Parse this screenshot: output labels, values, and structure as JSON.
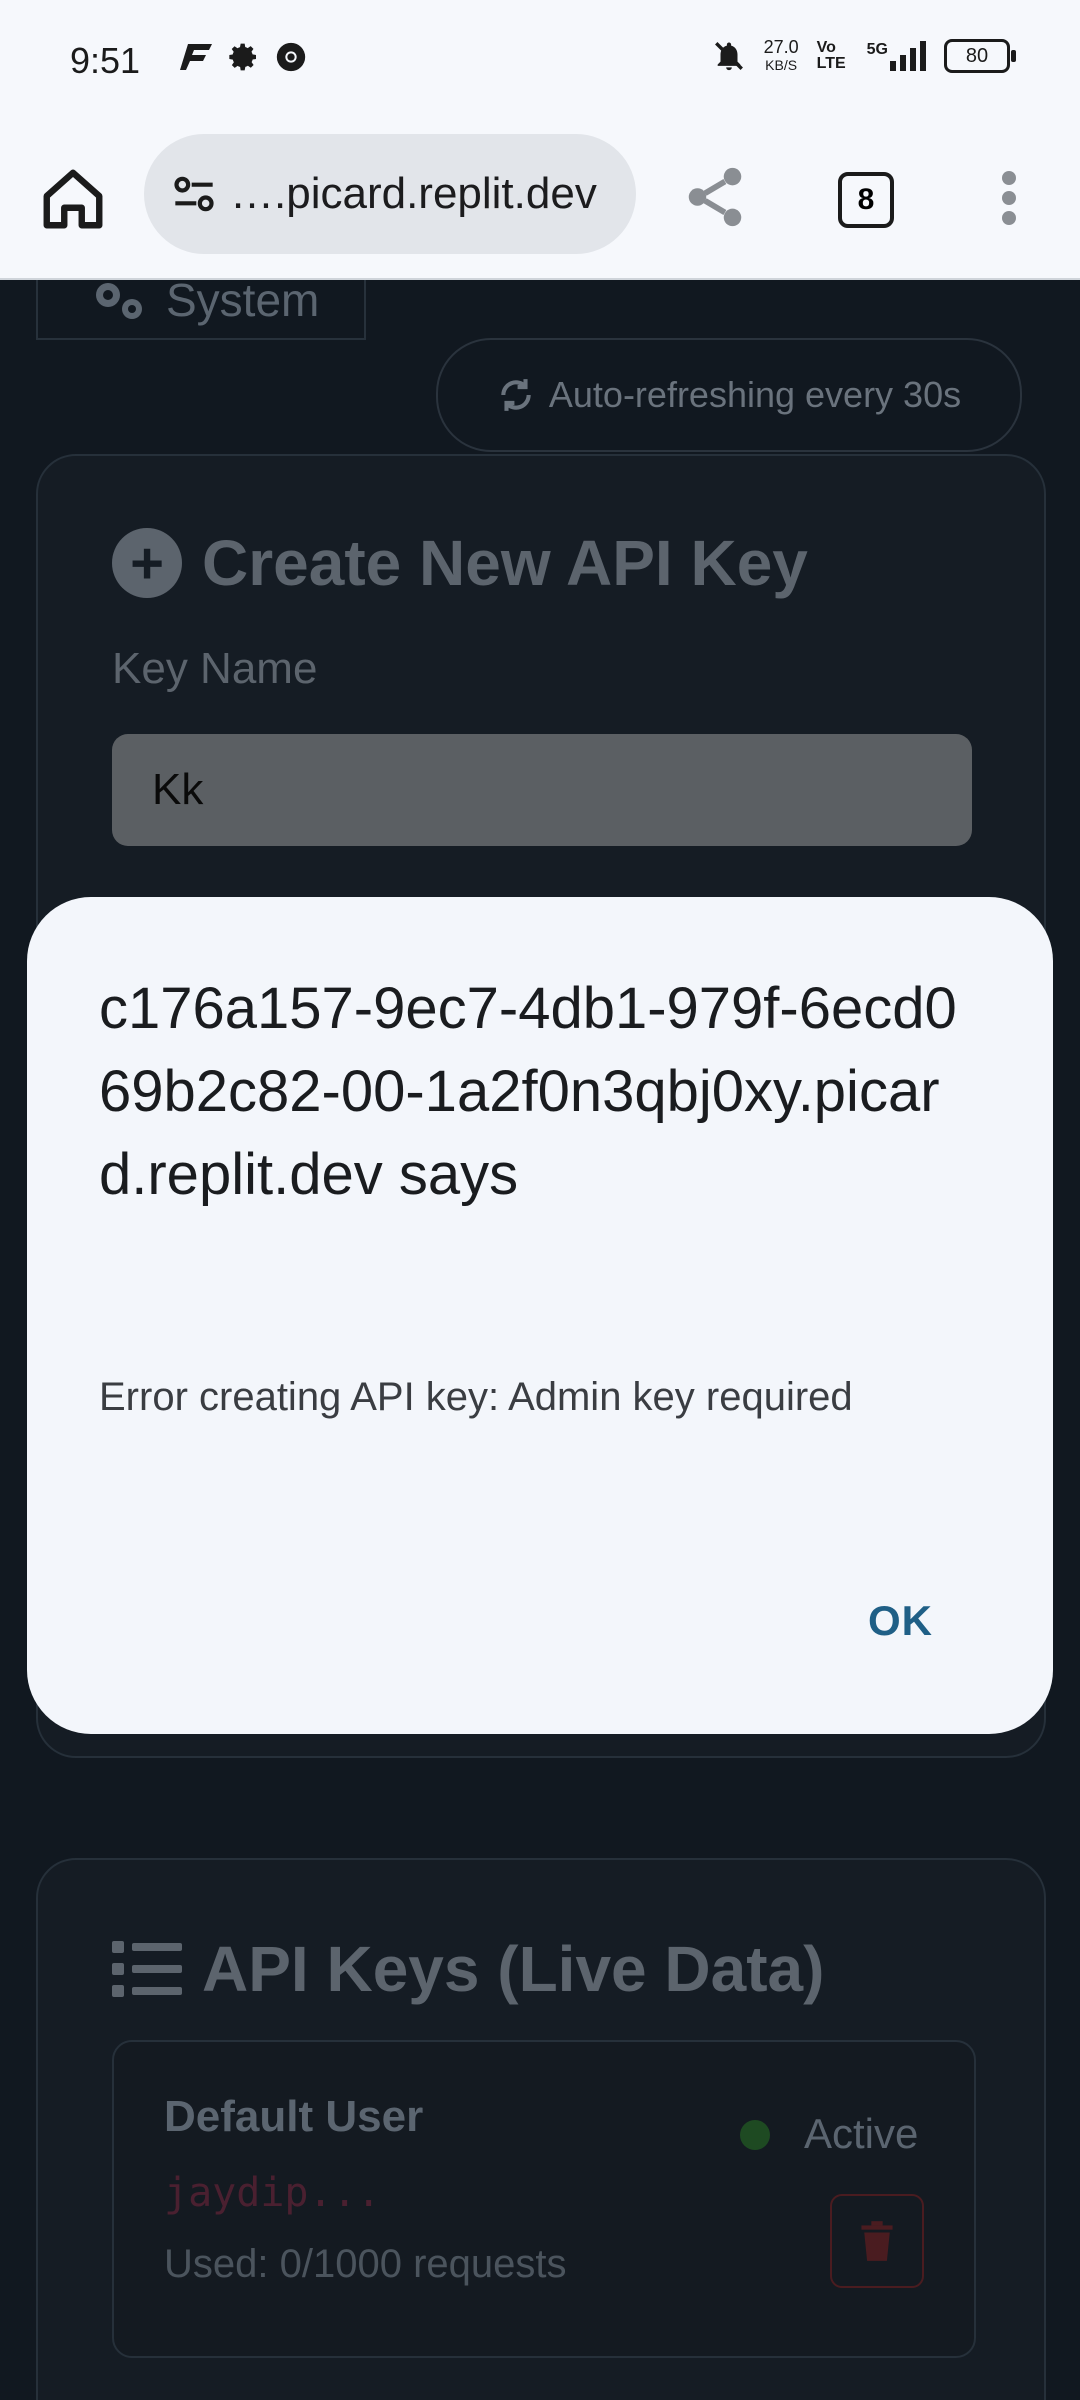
{
  "status_bar": {
    "time": "9:51",
    "net_speed_value": "27.0",
    "net_speed_unit": "KB/S",
    "volte": "Vo LTE",
    "network": "5G",
    "battery": "80"
  },
  "browser": {
    "url_display": "….picard.replit.dev",
    "tab_count": "8"
  },
  "page": {
    "tab_system_label": "System",
    "auto_refresh_label": "Auto-refreshing every 30s",
    "create_card": {
      "title": "Create New API Key",
      "key_name_label": "Key Name",
      "key_name_value": "Kk"
    },
    "keys_card": {
      "title": "API Keys (Live Data)",
      "items": [
        {
          "user": "Default User",
          "key_preview": "jaydip...",
          "usage": "Used: 0/1000 requests",
          "status": "Active"
        }
      ]
    }
  },
  "dialog": {
    "title": "c176a157-9ec7-4db1-979f-6ecd069b2c82-00-1a2f0n3qbj0xy.picard.replit.dev says",
    "message": "Error creating API key: Admin key required",
    "ok_label": "OK"
  },
  "colors": {
    "dialog_bg": "#f3f6fb",
    "ok_text": "#1f5f86",
    "page_bg": "#111820",
    "status_active": "#1e4a22"
  }
}
